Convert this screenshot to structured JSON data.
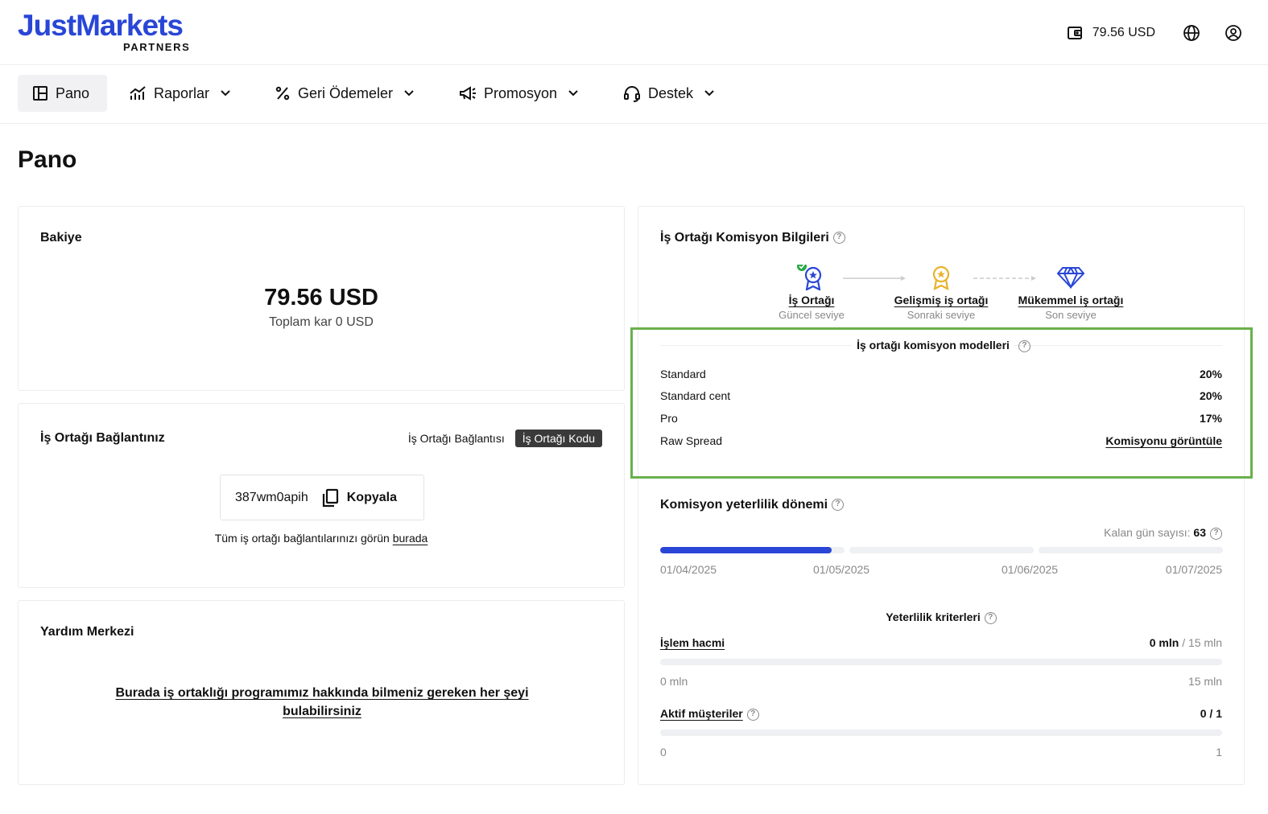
{
  "brand": {
    "name": "JustMarkets",
    "sub": "PARTNERS"
  },
  "topbar": {
    "balance": "79.56 USD"
  },
  "nav": {
    "items": [
      {
        "label": "Pano"
      },
      {
        "label": "Raporlar"
      },
      {
        "label": "Geri Ödemeler"
      },
      {
        "label": "Promosyon"
      },
      {
        "label": "Destek"
      }
    ]
  },
  "page_title": "Pano",
  "balance_card": {
    "title": "Bakiye",
    "amount": "79.56 USD",
    "total_profit": "Toplam kar 0 USD"
  },
  "link_card": {
    "title": "İş Ortağı Bağlantınız",
    "tab_link": "İş Ortağı Bağlantısı",
    "tab_code": "İş Ortağı Kodu",
    "code": "387wm0apih",
    "copy_label": "Kopyala",
    "all_links_text": "Tüm iş ortağı bağlantılarınızı görün",
    "all_links_link": "burada"
  },
  "help_card": {
    "title": "Yardım Merkezi",
    "link_line1": "Burada iş ortaklığı programımız hakkında bilmeniz gereken her şeyi",
    "link_line2": "bulabilirsiniz"
  },
  "commission_card": {
    "title": "İş Ortağı Komisyon Bilgileri",
    "levels": [
      {
        "name": "İş Ortağı",
        "sub": "Güncel seviye"
      },
      {
        "name": "Gelişmiş iş ortağı",
        "sub": "Sonraki seviye"
      },
      {
        "name": "Mükemmel iş ortağı",
        "sub": "Son seviye"
      }
    ],
    "models_title": "İş ortağı komisyon modelleri",
    "models": [
      {
        "name": "Standard",
        "value": "20%"
      },
      {
        "name": "Standard cent",
        "value": "20%"
      },
      {
        "name": "Pro",
        "value": "17%"
      },
      {
        "name": "Raw Spread",
        "value": "Komisyonu görüntüle"
      }
    ],
    "period_title": "Komisyon yeterlilik dönemi",
    "days_label": "Kalan gün sayısı:",
    "days_value": "63",
    "period_progress": 0.93,
    "dates": [
      "01/04/2025",
      "01/05/2025",
      "01/06/2025",
      "01/07/2025"
    ],
    "criteria_title": "Yeterlilik kriterleri",
    "criteria": [
      {
        "name": "İşlem hacmi",
        "value": "0 mln",
        "target": "/ 15 mln",
        "min": "0 mln",
        "max": "15 mln",
        "progress": 0
      },
      {
        "name": "Aktif müşteriler",
        "value": "0 / 1",
        "min": "0",
        "max": "1",
        "progress": 0
      }
    ]
  },
  "colors": {
    "brand": "#2946d6",
    "highlight": "#6ab04c",
    "success": "#27a844",
    "gold": "#e9b22c"
  }
}
